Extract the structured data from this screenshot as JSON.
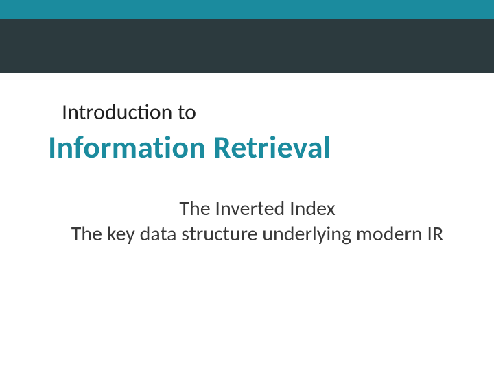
{
  "slide": {
    "eyebrow": "Introduction to",
    "title": "Information Retrieval",
    "subtitle_line1": "The Inverted Index",
    "subtitle_line2": "The key data structure underlying modern IR"
  },
  "colors": {
    "accent": "#1b8b9e",
    "dark_band": "#2c3a3e"
  }
}
